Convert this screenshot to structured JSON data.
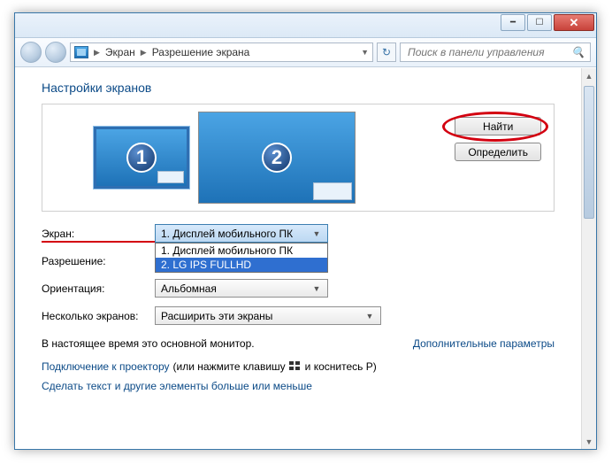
{
  "titlebar": {
    "min": "▁",
    "max": "▢",
    "close": "✕"
  },
  "nav": {
    "crumb1": "Экран",
    "crumb2": "Разрешение экрана",
    "search_placeholder": "Поиск в панели управления"
  },
  "heading": "Настройки экранов",
  "monitors": {
    "num1": "1",
    "num2": "2"
  },
  "buttons": {
    "find": "Найти",
    "identify": "Определить"
  },
  "form": {
    "display_label": "Экран:",
    "display_value": "1. Дисплей мобильного ПК",
    "display_options": [
      "1. Дисплей мобильного ПК",
      "2. LG IPS FULLHD"
    ],
    "resolution_label": "Разрешение:",
    "orientation_label": "Ориентация:",
    "orientation_value": "Альбомная",
    "multi_label": "Несколько экранов:",
    "multi_value": "Расширить эти экраны"
  },
  "main_monitor_text": "В настоящее время это основной монитор.",
  "advanced_link": "Дополнительные параметры",
  "projector_prefix": "Подключение к проектору",
  "projector_hint_a": " (или нажмите клавишу ",
  "projector_hint_b": " и коснитесь P)",
  "textsize_link": "Сделать текст и другие элементы больше или меньше"
}
